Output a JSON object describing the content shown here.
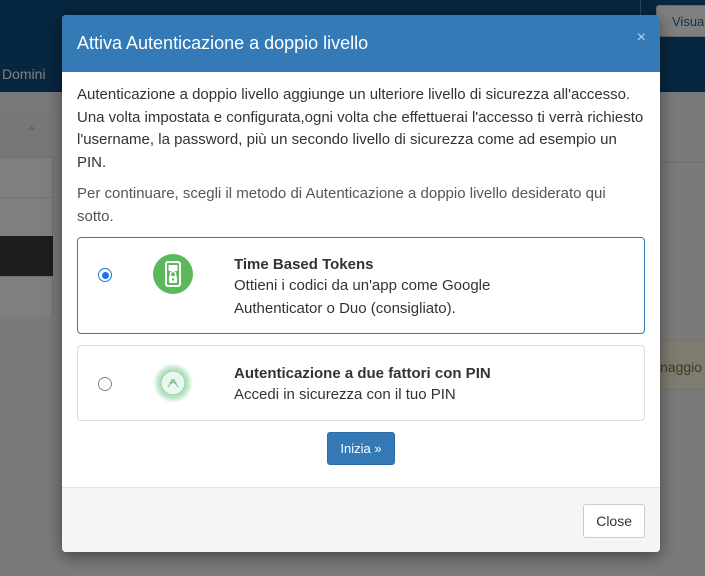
{
  "background": {
    "top_button_label": "Visua",
    "nav_item": "Domini",
    "alert_text": "naggio"
  },
  "modal": {
    "title": "Attiva Autenticazione a doppio livello",
    "close_symbol": "×",
    "intro": "Autenticazione a doppio livello aggiunge un ulteriore livello di sicurezza all'accesso. Una volta impostata e configurata,ogni volta che effettuerai l'accesso ti verrà richiesto l'username, la password, più un secondo livello di sicurezza come ad esempio un PIN.",
    "instruction": "Per continuare, scegli il metodo di Autenticazione a doppio livello desiderato qui sotto.",
    "options": [
      {
        "title": "Time Based Tokens",
        "description": "Ottieni i codici da un'app come Google Authenticator o Duo (consigliato).",
        "selected": true,
        "icon": "phone-lock-icon"
      },
      {
        "title": "Autenticazione a due fattori con PIN",
        "description": "Accedi in sicurezza con il tuo PIN",
        "selected": false,
        "icon": "pin-fingerprint-icon"
      }
    ],
    "start_button": "Inizia »",
    "close_button": "Close"
  },
  "colors": {
    "header": "#337ab7",
    "topbar": "#0f4c7e",
    "icon_green": "#5cb85c"
  }
}
